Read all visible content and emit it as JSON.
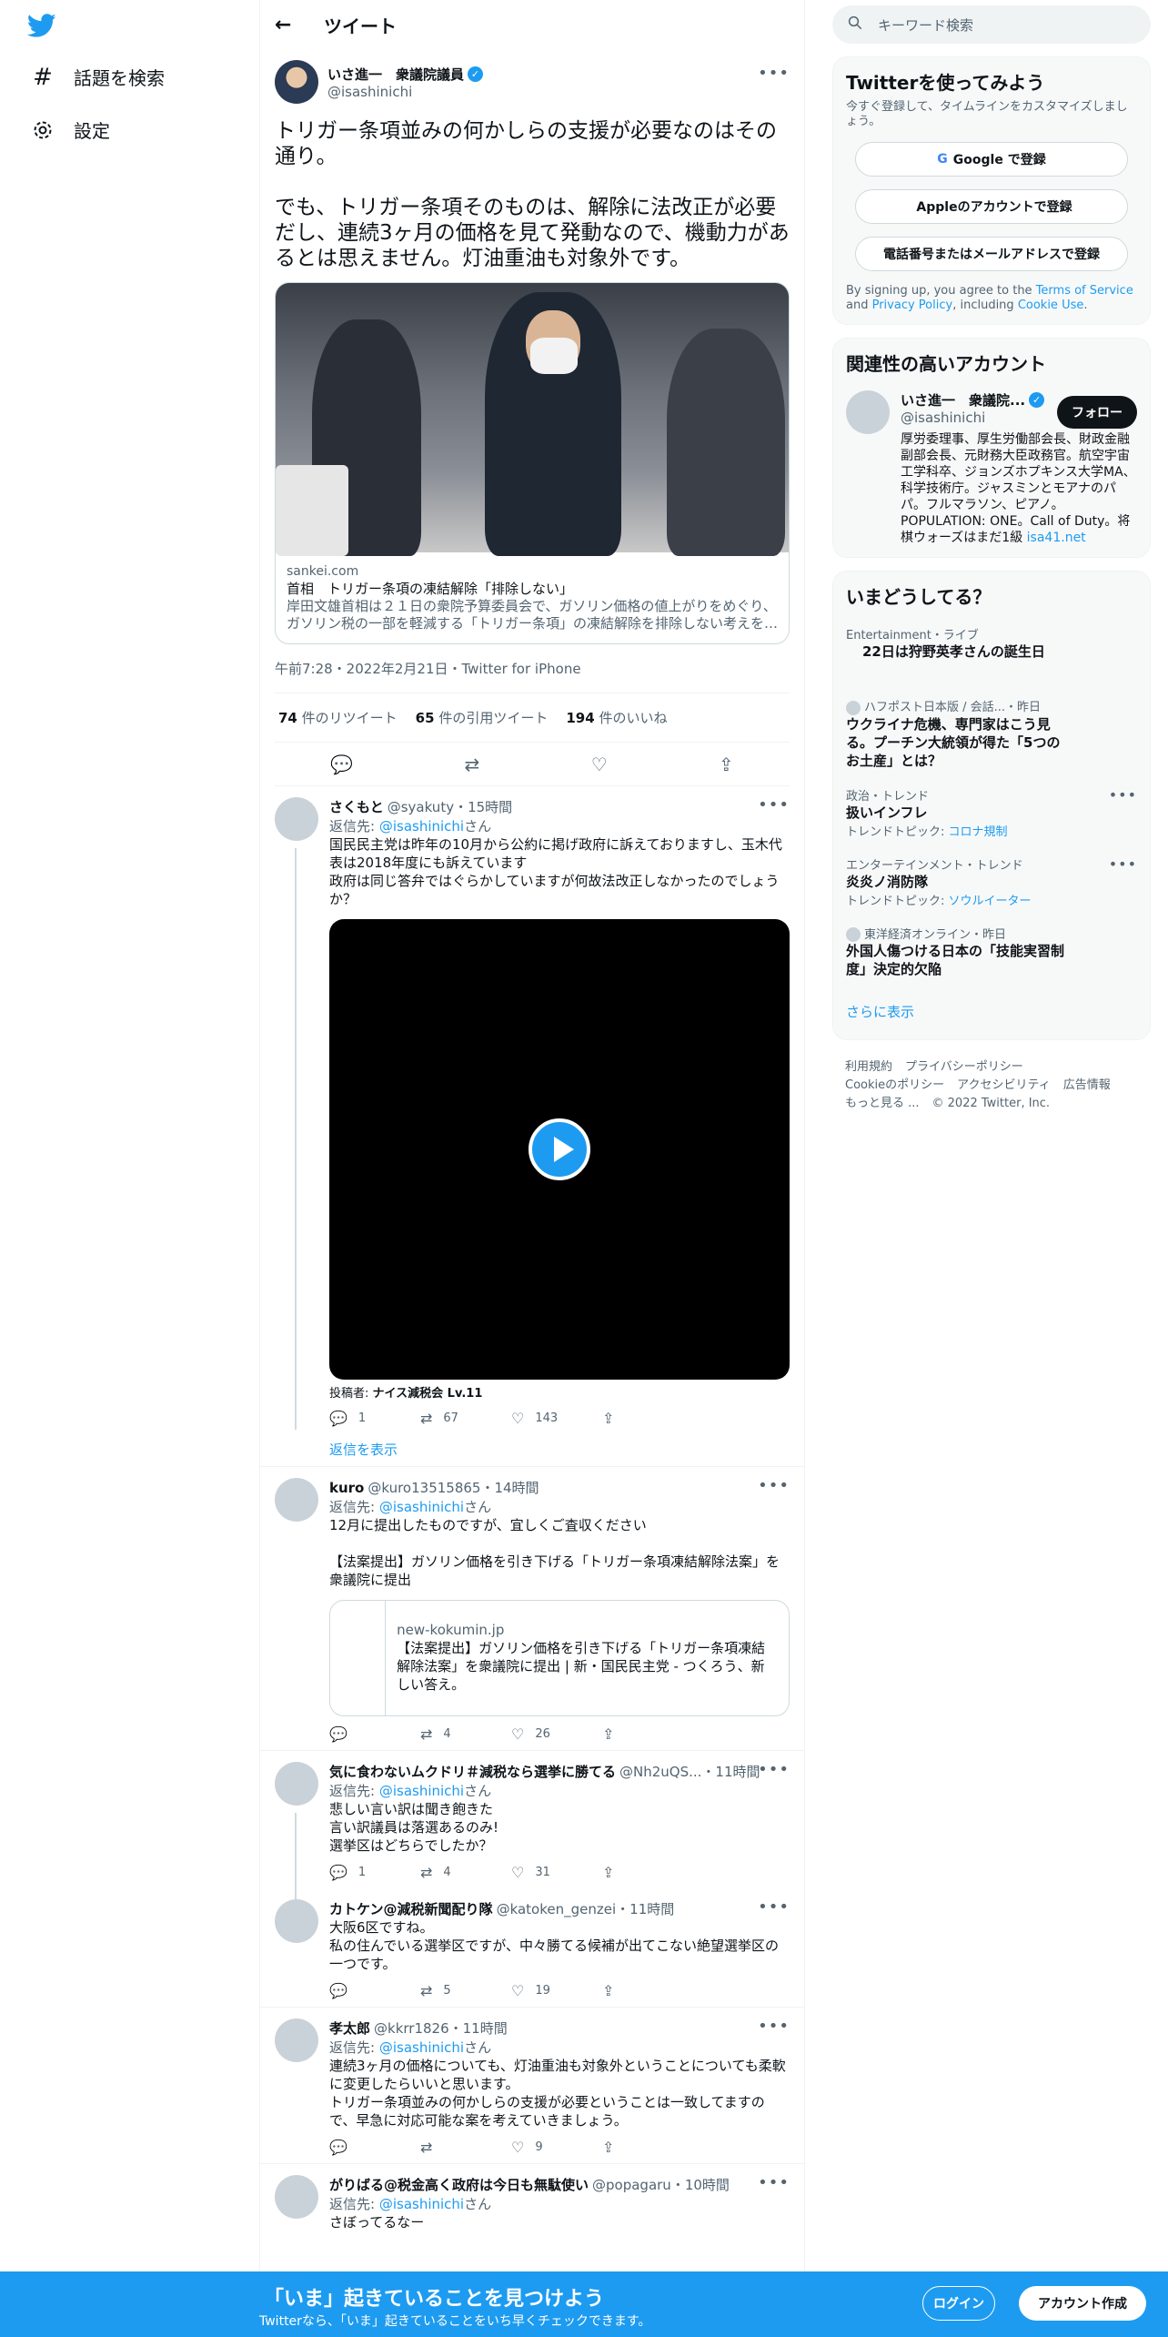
{
  "nav": {
    "explore": "話題を検索",
    "settings": "設定"
  },
  "header": {
    "back": "←",
    "title": "ツイート"
  },
  "tweet": {
    "name": "いさ進一　衆議院議員",
    "handle": "@isashinichi",
    "text": "トリガー条項並みの何かしらの支援が必要なのはその通り。\n\nでも、トリガー条項そのものは、解除に法改正が必要だし、連続3ヶ月の価格を見て発動なので、機動力があるとは思えません。灯油重油も対象外です。",
    "card": {
      "domain": "sankei.com",
      "title": "首相　トリガー条項の凍結解除「排除しない」",
      "desc": "岸田文雄首相は２１日の衆院予算委員会で、ガソリン価格の値上がりをめぐり、ガソリン税の一部を軽減する「トリガー条項」の凍結解除を排除しない考えを…"
    },
    "meta": "午前7:28・2022年2月21日・Twitter for iPhone",
    "retweets": "74",
    "retweets_label": "件のリツイート",
    "quotes": "65",
    "quotes_label": "件の引用ツイート",
    "likes": "194",
    "likes_label": "件のいいね"
  },
  "replies": [
    {
      "name": "さくもと",
      "handle": "@syakuty・15時間",
      "reply_to_prefix": "返信先:",
      "reply_to": "@isashinichi",
      "reply_to_suffix": "さん",
      "text": "国民民主党は昨年の10月から公約に掲げ政府に訴えておりますし、玉木代表は2018年度にも訴えています\n政府は同じ答弁ではぐらかしていますが何故法改正しなかったのでしょうか？",
      "poster_label": "投稿者:",
      "poster": "ナイス減税会 Lv.11",
      "replies": "1",
      "retweets": "67",
      "likes": "143",
      "show_replies": "返信を表示"
    },
    {
      "name": "kuro",
      "handle": "@kuro13515865・14時間",
      "reply_to_prefix": "返信先:",
      "reply_to": "@isashinichi",
      "reply_to_suffix": "さん",
      "text": "12月に提出したものですが、宜しくご査収ください\n\n【法案提出】ガソリン価格を引き下げる「トリガー条項凍結解除法案」を衆議院に提出",
      "link_domain": "new-kokumin.jp",
      "link_title": "【法案提出】ガソリン価格を引き下げる「トリガー条項凍結解除法案」を衆議院に提出 | 新・国民民主党 - つくろう、新しい答え。",
      "replies": "",
      "retweets": "4",
      "likes": "26"
    },
    {
      "name": "気に食わないムクドリ＃減税なら選挙に勝てる",
      "handle": "@Nh2uQS...・11時間",
      "reply_to_prefix": "返信先:",
      "reply_to": "@isashinichi",
      "reply_to_suffix": "さん",
      "text": "悲しい言い訳は聞き飽きた\n言い訳議員は落選あるのみ!\n選挙区はどちらでしたか？",
      "replies": "1",
      "retweets": "4",
      "likes": "31"
    },
    {
      "name": "カトケン@減税新聞配り隊",
      "handle": "@katoken_genzei・11時間",
      "text": "大阪6区ですね。\n私の住んでいる選挙区ですが、中々勝てる候補が出てこない絶望選挙区の一つです。",
      "replies": "",
      "retweets": "5",
      "likes": "19"
    },
    {
      "name": "孝太郎",
      "handle": "@kkrr1826・11時間",
      "reply_to_prefix": "返信先:",
      "reply_to": "@isashinichi",
      "reply_to_suffix": "さん",
      "text": "連続3ヶ月の価格についても、灯油重油も対象外ということについても柔軟に変更したらいいと思います。\nトリガー条項並みの何かしらの支援が必要ということは一致してますので、早急に対応可能な案を考えていきましょう。",
      "replies": "",
      "retweets": "",
      "likes": "9"
    },
    {
      "name": "がりばる@税金高く政府は今日も無駄使い",
      "handle": "@popagaru・10時間",
      "reply_to_prefix": "返信先:",
      "reply_to": "@isashinichi",
      "reply_to_suffix": "さん",
      "text": "さぼってるなー"
    }
  ],
  "sidebar": {
    "search_placeholder": "キーワード検索",
    "signup": {
      "title": "Twitterを使ってみよう",
      "sub": "今すぐ登録して、タイムラインをカスタマイズしましょう。",
      "google": "Google で登録",
      "apple": "Appleのアカウントで登録",
      "phone": "電話番号またはメールアドレスで登録",
      "terms_pre": "By signing up, you agree to the ",
      "terms_tos": "Terms of Service",
      "terms_and": " and ",
      "terms_pp": "Privacy Policy",
      "terms_inc": ", including ",
      "terms_cookie": "Cookie Use",
      "terms_end": "."
    },
    "relevant": {
      "title": "関連性の高いアカウント",
      "name": "いさ進一　衆議院...",
      "handle": "@isashinichi",
      "follow": "フォロー",
      "bio": "厚労委理事、厚生労働部会長、財政金融副部会長、元財務大臣政務官。航空宇宙工学科卒、ジョンズホプキンス大学MA、科学技術庁。ジャスミンとモアナのパパ。フルマラソン、ピアノ。POPULATION: ONE。Call of Duty。将棋ウォーズはまだ1級 ",
      "bio_link": "isa41.net"
    },
    "trends": {
      "title": "いまどうしてる？",
      "items": [
        {
          "cat": "Entertainment・ライブ",
          "title": "22日は狩野英孝さんの誕生日"
        },
        {
          "cat": "ハフポスト日本版 / 会話...・昨日",
          "title": "ウクライナ危機、専門家はこう見る。プーチン大統領が得た「5つのお土産」とは？"
        },
        {
          "cat": "政治・トレンド",
          "title": "扱いインフレ",
          "topic_prefix": "トレンドトピック: ",
          "topic": "コロナ規制"
        },
        {
          "cat": "エンターテインメント・トレンド",
          "title": "炎炎ノ消防隊",
          "topic_prefix": "トレンドトピック: ",
          "topic": "ソウルイーター"
        },
        {
          "cat": "東洋経済オンライン・昨日",
          "title": "外国人傷つける日本の「技能実習制度」決定的欠陥"
        }
      ],
      "more": "さらに表示"
    },
    "footer": {
      "terms": "利用規約",
      "privacy": "プライバシーポリシー",
      "cookie": "Cookieのポリシー",
      "access": "アクセシビリティ",
      "ads": "広告情報",
      "more": "もっと見る ...",
      "copy": "© 2022 Twitter, Inc."
    }
  },
  "bottom": {
    "title": "「いま」起きていることを見つけよう",
    "sub": "Twitterなら、「いま」起きていることをいち早くチェックできます。",
    "login": "ログイン",
    "signup": "アカウント作成"
  },
  "colors": {
    "accent": "#1d9bf0",
    "text": "#0f1419",
    "muted": "#536471"
  }
}
